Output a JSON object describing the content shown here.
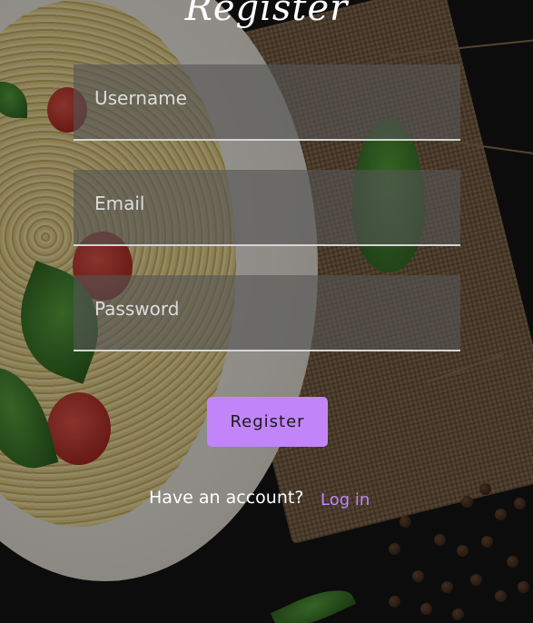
{
  "page": {
    "title": "Register"
  },
  "form": {
    "username": {
      "placeholder": "Username",
      "value": ""
    },
    "email": {
      "placeholder": "Email",
      "value": ""
    },
    "password": {
      "placeholder": "Password",
      "value": ""
    },
    "submit_label": "Register"
  },
  "footer": {
    "prompt": "Have an account?",
    "login_link": "Log in"
  },
  "colors": {
    "accent": "#c285f9",
    "background": "#141414",
    "field_background": "#555555",
    "text": "#ffffff"
  },
  "background_image": {
    "icon": "spaghetti-plate-on-burlap-photo"
  }
}
